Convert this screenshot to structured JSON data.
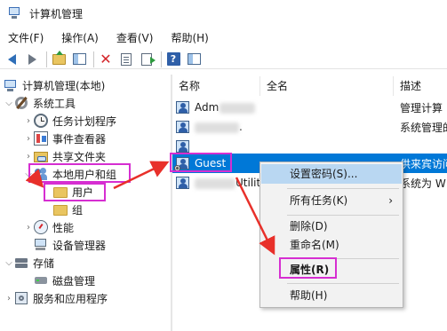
{
  "window": {
    "title": "计算机管理"
  },
  "menu": {
    "items": [
      "文件(F)",
      "操作(A)",
      "查看(V)",
      "帮助(H)"
    ]
  },
  "toolbar": {
    "icons": [
      "back-icon",
      "forward-icon",
      "up-folder-icon",
      "show-pane-icon",
      "delete-icon",
      "properties-icon",
      "export-icon",
      "help-icon",
      "action-pane-icon"
    ]
  },
  "tree": {
    "root": "计算机管理(本地)",
    "system_tools": "系统工具",
    "task_scheduler": "任务计划程序",
    "event_viewer": "事件查看器",
    "shared_folders": "共享文件夹",
    "local_users_groups": "本地用户和组",
    "users": "用户",
    "groups": "组",
    "performance": "性能",
    "device_manager": "设备管理器",
    "storage": "存储",
    "disk_management": "磁盘管理",
    "services_apps": "服务和应用程序"
  },
  "columns": {
    "name": "名称",
    "full_name": "全名",
    "description": "描述"
  },
  "users_list": [
    {
      "name": "Adm",
      "full_name": "",
      "description": "管理计算"
    },
    {
      "name": "",
      "full_name": ".",
      "description": "系统管理的"
    },
    {
      "name": "",
      "full_name": "",
      "description": ""
    },
    {
      "name": "Guest",
      "full_name": "",
      "description": "供来宾访问"
    },
    {
      "name": "",
      "full_name": "Utilit...",
      "description": "系统为 W"
    }
  ],
  "context_menu": {
    "set_password": "设置密码(S)...",
    "all_tasks": "所有任务(K)",
    "delete": "删除(D)",
    "rename": "重命名(M)",
    "properties": "属性(R)",
    "help": "帮助(H)"
  },
  "colors": {
    "highlight_box": "#d62ed1",
    "annotation_arrow": "#e8302a",
    "selection": "#0078d7",
    "menu_hover": "#b9d7f2"
  }
}
